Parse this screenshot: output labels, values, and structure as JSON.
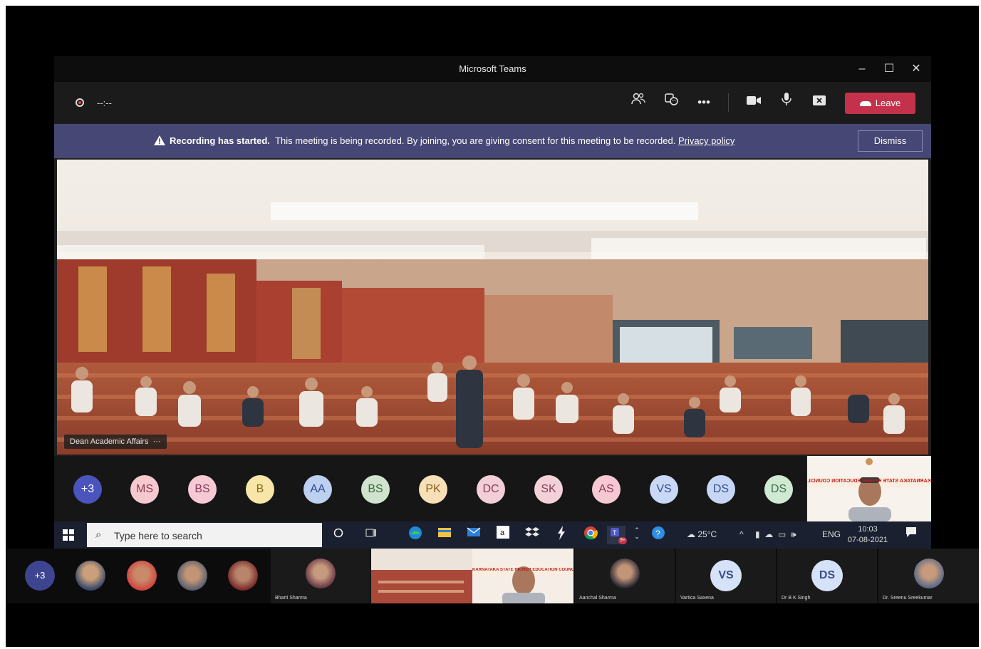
{
  "window": {
    "title": "Microsoft Teams",
    "controls": [
      "–",
      "☐",
      "✕"
    ]
  },
  "toolbar": {
    "timer": "--:--",
    "leave_label": "Leave"
  },
  "banner": {
    "bold": "Recording has started.",
    "text": "This meeting is being recorded. By joining, you are giving consent for this meeting to be recorded.",
    "link": "Privacy policy",
    "dismiss": "Dismiss"
  },
  "video": {
    "speaker_label": "Dean Academic Affairs",
    "speaker_more": "···"
  },
  "participants": [
    {
      "initials": "+3",
      "bg": "#4b53bc",
      "fg": "#ffffff"
    },
    {
      "initials": "MS",
      "bg": "#f6c9d0",
      "fg": "#8a3c4e"
    },
    {
      "initials": "BS",
      "bg": "#f6c9d5",
      "fg": "#8a3c5a"
    },
    {
      "initials": "B",
      "bg": "#f7e6a8",
      "fg": "#8a6a1a"
    },
    {
      "initials": "AA",
      "bg": "#bcd0f0",
      "fg": "#2f4a8a"
    },
    {
      "initials": "BS",
      "bg": "#cfe3cf",
      "fg": "#3d6a3d"
    },
    {
      "initials": "PK",
      "bg": "#f7e0b8",
      "fg": "#8a5e1f"
    },
    {
      "initials": "DC",
      "bg": "#f2cfd8",
      "fg": "#8a3c50"
    },
    {
      "initials": "SK",
      "bg": "#f2d2d8",
      "fg": "#8a4050"
    },
    {
      "initials": "AS",
      "bg": "#f6c8d4",
      "fg": "#8a3c54"
    },
    {
      "initials": "VS",
      "bg": "#c9d8f5",
      "fg": "#34508f"
    },
    {
      "initials": "DS",
      "bg": "#c6d6f4",
      "fg": "#34508f"
    },
    {
      "initials": "DS",
      "bg": "#cfe9d3",
      "fg": "#3d7048"
    }
  ],
  "karnataka": {
    "banner_text": "KARNATAKA STATE HIGHER EDUCATION COUNCIL"
  },
  "taskbar": {
    "search_placeholder": "Type here to search",
    "weather": "25°C",
    "lang": "ENG",
    "time": "10:03",
    "date": "07-08-2021",
    "teams_badge": "9+"
  },
  "gallery": {
    "plus": "+3",
    "names": {
      "bharti": "Bharti Sharma",
      "aanchal": "Aanchal Sharma",
      "vartica": "Vartica Saxena",
      "drbk": "Dr B K Singh",
      "sreenu": "Dr. Sreenu Sreekumar"
    },
    "vs": "VS",
    "ds": "DS"
  },
  "colors": {
    "banner_bg": "#464775",
    "leave_bg": "#c4314b",
    "teams_bg": "#1f1f1f"
  }
}
